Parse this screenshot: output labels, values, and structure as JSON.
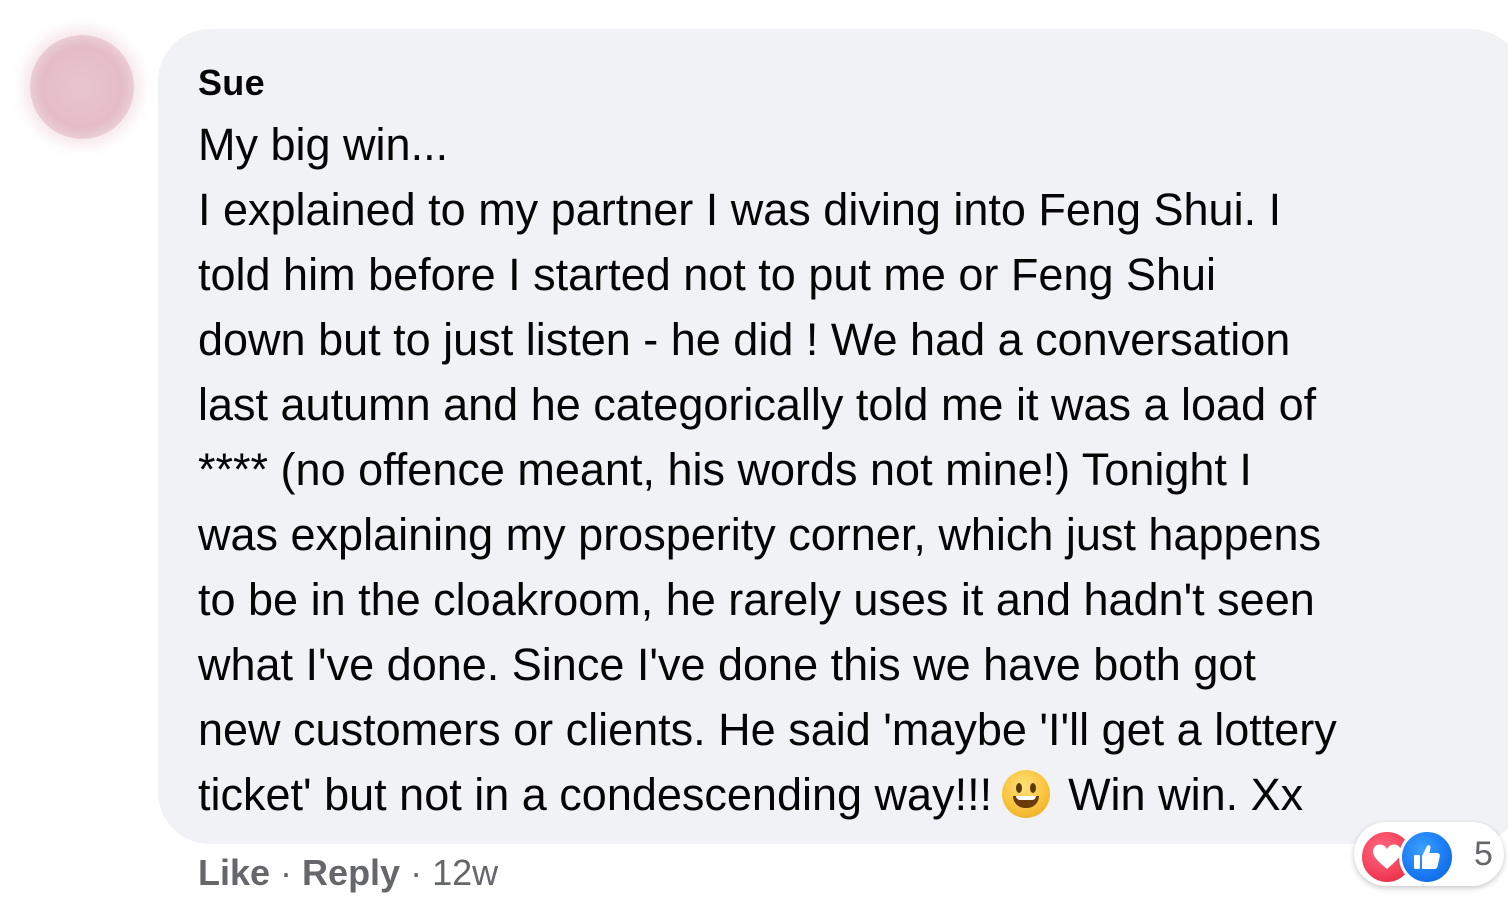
{
  "comment": {
    "author": "Sue",
    "lines": [
      "My big win...",
      "I explained to my partner I was diving into Feng Shui. I",
      "told him before I started not to put me or Feng Shui",
      "down but to just listen - he did ! We had a conversation",
      "last autumn and he categorically told me it was a load of",
      "**** (no offence meant, his words not mine!) Tonight I",
      "was explaining my prosperity corner, which just happens",
      "to be in the cloakroom, he rarely uses it and hadn't seen",
      "what I've done. Since I've done this we have both got",
      "new customers or clients. He said 'maybe 'I'll get a lottery",
      "ticket' but not in a condescending way!!!"
    ],
    "after_emoji": "Win win. Xx",
    "emoji": "grinning-face-emoji"
  },
  "reactions": {
    "icons": [
      "love-icon",
      "like-icon"
    ],
    "count": "5"
  },
  "actions": {
    "like_label": "Like",
    "reply_label": "Reply",
    "separator": "·",
    "timestamp": "12w"
  },
  "colors": {
    "bubble": "#f0f2f5",
    "text": "#050505",
    "meta": "#65676b",
    "love": "#f33e58",
    "like": "#1877f2"
  }
}
